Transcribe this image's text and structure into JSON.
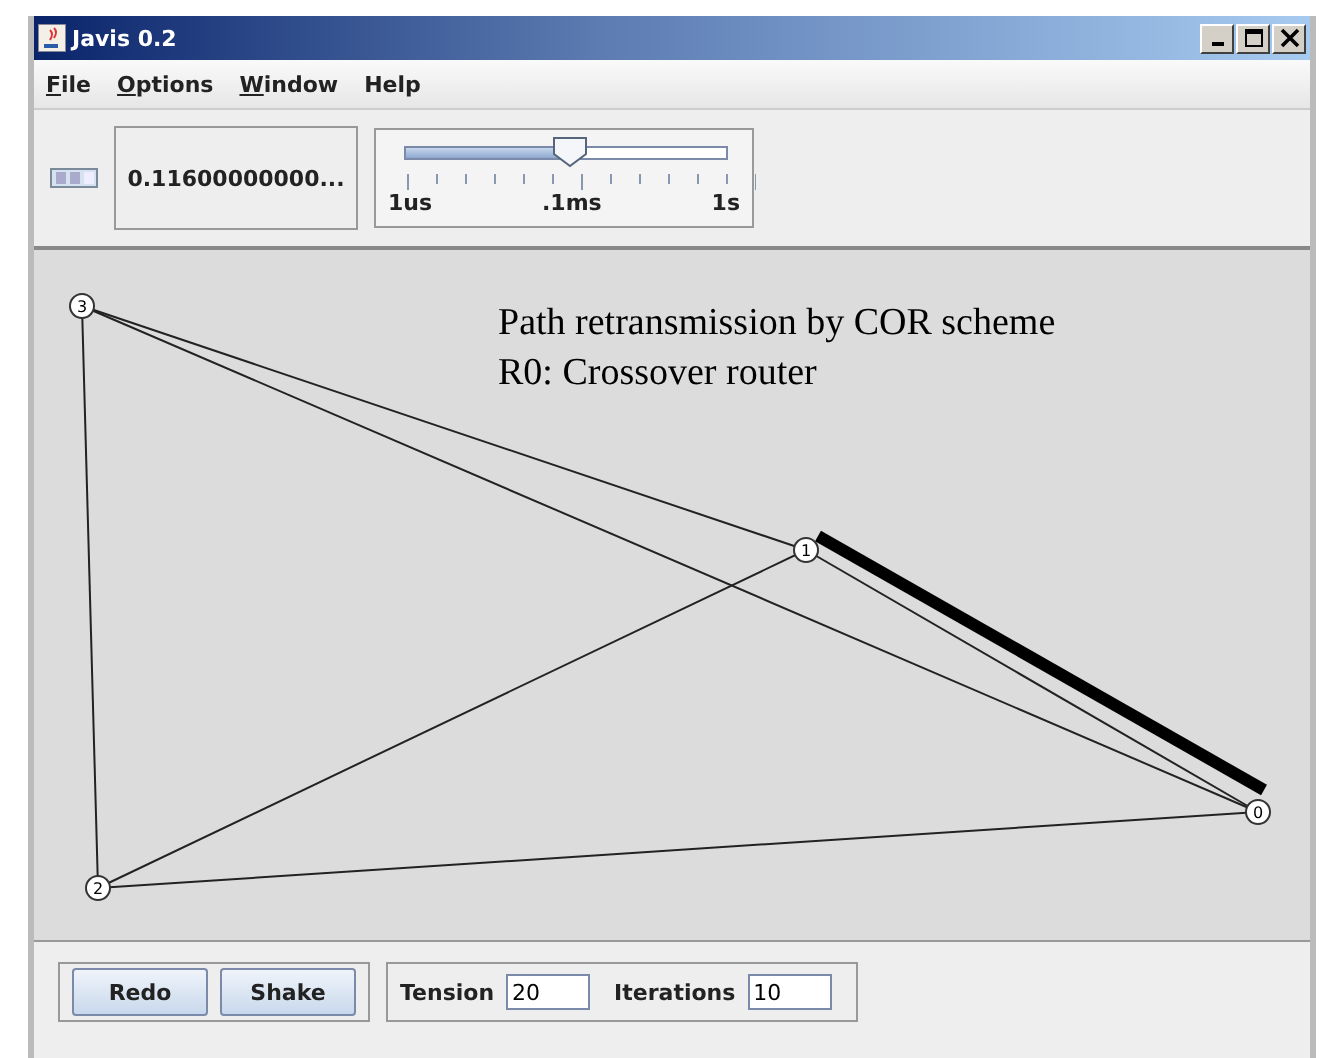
{
  "window": {
    "title": "Javis 0.2"
  },
  "menu": [
    {
      "label": "File",
      "mnemonic_underlined": true
    },
    {
      "label": "Options",
      "mnemonic_underlined": true
    },
    {
      "label": "Window",
      "mnemonic_underlined": true
    },
    {
      "label": "Help",
      "mnemonic_underlined": false
    }
  ],
  "toolbar": {
    "time_display": "0.11600000000...",
    "speed_slider": {
      "level": 0.51,
      "tick_labels": [
        "1us",
        ".1ms",
        "1s"
      ]
    }
  },
  "graph": {
    "caption": [
      "Path retransmission by COR scheme",
      "R0: Crossover router"
    ],
    "nodes": [
      {
        "label": "3"
      },
      {
        "label": "1"
      },
      {
        "label": "0"
      },
      {
        "label": "2"
      }
    ],
    "links": [
      {
        "highlighted": false
      },
      {
        "highlighted": false
      },
      {
        "highlighted": false
      },
      {
        "highlighted": false
      },
      {
        "highlighted": false
      },
      {
        "highlighted": false
      },
      {
        "highlighted": true
      }
    ]
  },
  "bottom": {
    "buttons": [
      "Redo",
      "Shake"
    ],
    "fields": [
      {
        "label": "Tension",
        "value": "20"
      },
      {
        "label": "Iterations",
        "value": "10"
      }
    ]
  }
}
